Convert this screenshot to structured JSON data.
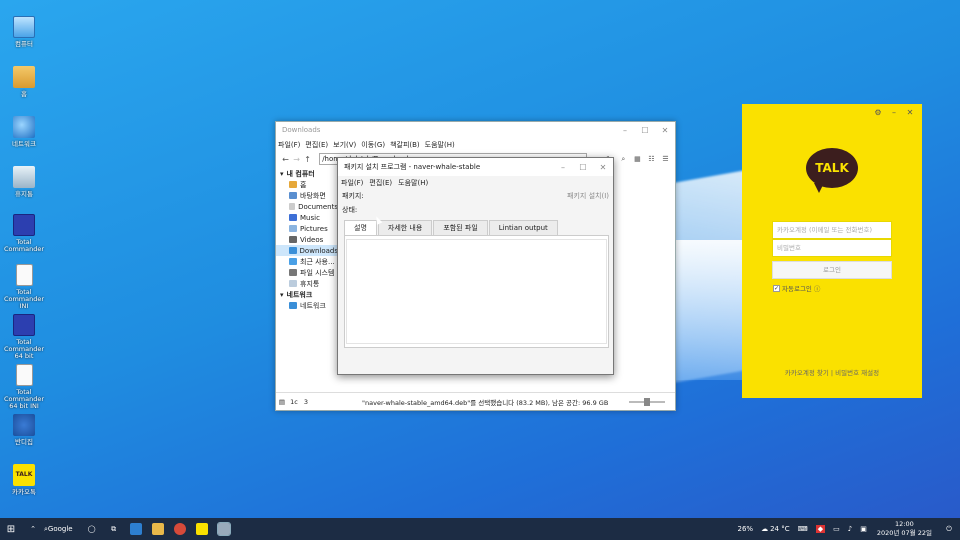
{
  "desktop": {
    "icons": [
      {
        "label": "컴퓨터",
        "icon": "computer-icon"
      },
      {
        "label": "홈",
        "icon": "home-folder-icon"
      },
      {
        "label": "네트워크",
        "icon": "network-icon"
      },
      {
        "label": "휴지통",
        "icon": "trash-icon"
      },
      {
        "label": "Total Commander",
        "icon": "floppy-icon"
      },
      {
        "label": "Total Commander INI",
        "icon": "document-icon"
      },
      {
        "label": "Total Commander 64 bit",
        "icon": "floppy-icon"
      },
      {
        "label": "Total Commander 64 bit INI",
        "icon": "document-icon"
      },
      {
        "label": "반디집",
        "icon": "bolt-icon"
      },
      {
        "label": "카카오톡",
        "icon": "kakaotalk-icon"
      }
    ]
  },
  "file_manager": {
    "title": "Downloads",
    "menu": [
      "파일(F)",
      "편집(E)",
      "보기(V)",
      "이동(G)",
      "책갈피(B)",
      "도움말(H)"
    ],
    "path": "/home/deb/ub/Downloads",
    "sidebar": {
      "computer_header": "내 컴퓨터",
      "items": [
        "홈",
        "바탕화면",
        "Documents",
        "Music",
        "Pictures",
        "Videos",
        "Downloads",
        "최근 사용...",
        "파일 시스템",
        "휴지통"
      ],
      "network_header": "네트워크",
      "network_items": [
        "네트워크"
      ],
      "selected": "Downloads"
    },
    "status": {
      "message": "\"naver-whale-stable_amd64.deb\"를 선택했습니다 (83.2 MB), 남은 공간: 96.9 GB",
      "btn1": "1c",
      "btn2": "3"
    }
  },
  "dialog": {
    "title": "패키지 설치 프로그램 - naver-whale-stable",
    "menu": [
      "파일(F)",
      "편집(E)",
      "도움말(H)"
    ],
    "package_label": "패키지:",
    "install_button": "패키지 설치(I)",
    "status_label": "상태:",
    "tabs": [
      "설명",
      "자세한 내용",
      "포함된 파일",
      "Lintian output"
    ],
    "active_tab": "설명"
  },
  "kakao": {
    "logo": "TALK",
    "id_placeholder": "카카오계정 (이메일 또는 전화번호)",
    "pw_placeholder": "비밀번호",
    "login_button": "로그인",
    "auto_login": "자동로그인",
    "links": "카카오계정 찾기 | 비밀번호 재설정"
  },
  "taskbar": {
    "search": "Google",
    "battery": "26%",
    "weather": "24 °C",
    "time": "12:00",
    "date": "2020년 07월 22일"
  }
}
